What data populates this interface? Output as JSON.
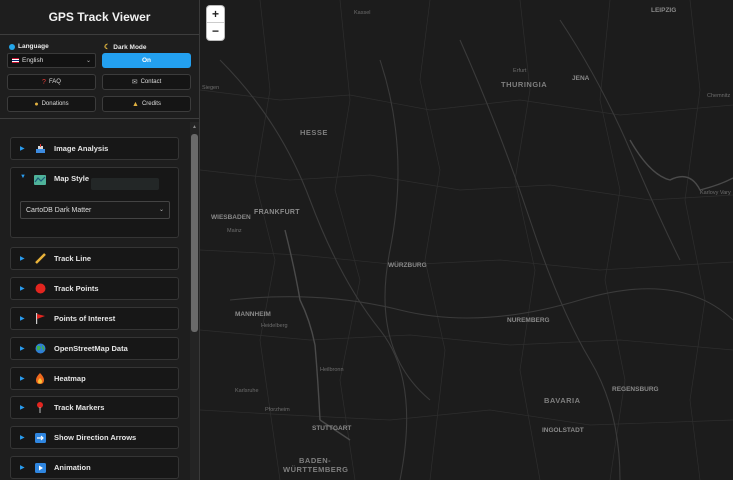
{
  "app": {
    "title": "GPS Track Viewer"
  },
  "settings": {
    "language_label": "Language",
    "language_value": "English",
    "dark_mode_label": "Dark Mode",
    "dark_mode_value": "On"
  },
  "buttons": {
    "faq": "FAQ",
    "contact": "Contact",
    "donations": "Donations",
    "credits": "Credits"
  },
  "sections": [
    {
      "label": "Image Analysis",
      "icon": "image-analysis-icon"
    },
    {
      "label": "Map Style",
      "icon": "map-icon",
      "expanded": true,
      "select_value": "CartoDB Dark Matter"
    },
    {
      "label": "Track Line",
      "icon": "ruler-icon"
    },
    {
      "label": "Track Points",
      "icon": "red-circle-icon"
    },
    {
      "label": "Points of Interest",
      "icon": "flag-icon"
    },
    {
      "label": "OpenStreetMap Data",
      "icon": "globe-icon"
    },
    {
      "label": "Heatmap",
      "icon": "fire-icon"
    },
    {
      "label": "Track Markers",
      "icon": "pushpin-icon"
    },
    {
      "label": "Show Direction Arrows",
      "icon": "arrow-right-icon"
    },
    {
      "label": "Animation",
      "icon": "play-icon"
    }
  ],
  "map": {
    "zoom_in": "+",
    "zoom_out": "−",
    "labels": {
      "kassel": "Kassel",
      "leipzig": "LEIPZIG",
      "erfurt": "Erfurt",
      "jena": "JENA",
      "thuringia": "THURINGIA",
      "chemnitz": "Chemnitz",
      "siegen": "Siegen",
      "hesse": "HESSE",
      "karlovy_vary": "Karlovy Vary",
      "wiesbaden": "WIESBADEN",
      "frankfurt": "FRANKFURT",
      "mainz": "Mainz",
      "wurzburg": "WÜRZBURG",
      "mannheim": "MANNHEIM",
      "heidelberg": "Heidelberg",
      "nuremberg": "NUREMBERG",
      "heilbronn": "Heilbronn",
      "karlsruhe": "Karlsruhe",
      "regensburg": "REGENSBURG",
      "bavaria": "BAVARIA",
      "pforzheim": "Pforzheim",
      "stuttgart": "STUTTGART",
      "ingolstadt": "INGOLSTADT",
      "baden_1": "BADEN-",
      "baden_2": "WÜRTTEMBERG"
    }
  },
  "colors": {
    "accent": "#23a0f0",
    "sidebar_bg": "#1e1e1e",
    "map_bg": "#1c1c1c"
  }
}
